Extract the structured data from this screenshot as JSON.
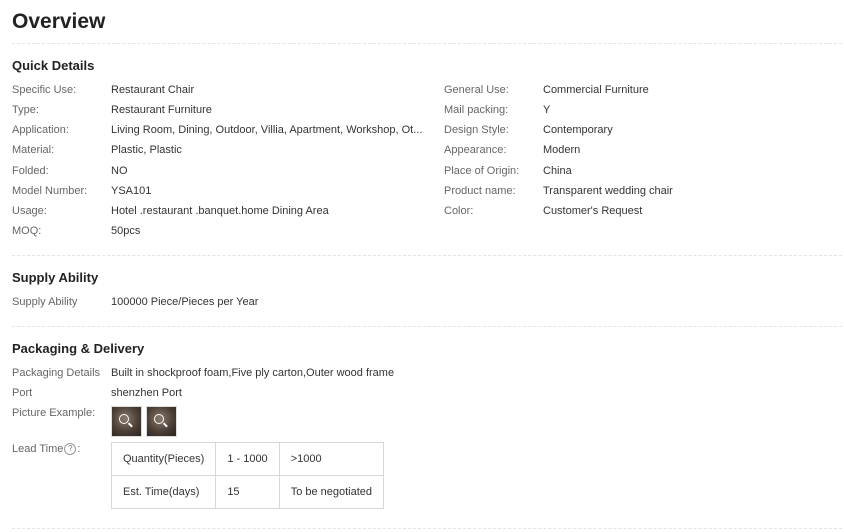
{
  "page": {
    "title": "Overview"
  },
  "quick_details": {
    "heading": "Quick Details",
    "left": [
      {
        "label": "Specific Use:",
        "value": "Restaurant Chair"
      },
      {
        "label": "Type:",
        "value": "Restaurant Furniture"
      },
      {
        "label": "Application:",
        "value": "Living Room, Dining, Outdoor, Villia, Apartment, Workshop, Ot..."
      },
      {
        "label": "Material:",
        "value": "Plastic, Plastic"
      },
      {
        "label": "Folded:",
        "value": "NO"
      },
      {
        "label": "Model Number:",
        "value": "YSA101"
      },
      {
        "label": "Usage:",
        "value": "Hotel .restaurant .banquet.home Dining Area"
      },
      {
        "label": "MOQ:",
        "value": "50pcs"
      }
    ],
    "right": [
      {
        "label": "General Use:",
        "value": "Commercial Furniture"
      },
      {
        "label": "Mail packing:",
        "value": "Y"
      },
      {
        "label": "Design Style:",
        "value": "Contemporary"
      },
      {
        "label": "Appearance:",
        "value": "Modern"
      },
      {
        "label": "Place of Origin:",
        "value": "China"
      },
      {
        "label": "Product name:",
        "value": "Transparent wedding chair"
      },
      {
        "label": "Color:",
        "value": "Customer's Request"
      }
    ]
  },
  "supply": {
    "heading": "Supply Ability",
    "label": "Supply Ability",
    "value": "100000 Piece/Pieces per Year"
  },
  "packaging": {
    "heading": "Packaging & Delivery",
    "details_label": "Packaging Details",
    "details_value": "Built in shockproof foam,Five ply carton,Outer wood frame",
    "port_label": "Port",
    "port_value": "shenzhen Port",
    "picture_label": "Picture Example:",
    "lead_label_pre": "Lead Time",
    "lead_help": "?",
    "lead_label_post": ":",
    "lead_table": {
      "row1": [
        "Quantity(Pieces)",
        "1 - 1000",
        ">1000"
      ],
      "row2": [
        "Est. Time(days)",
        "15",
        "To be negotiated"
      ]
    }
  }
}
